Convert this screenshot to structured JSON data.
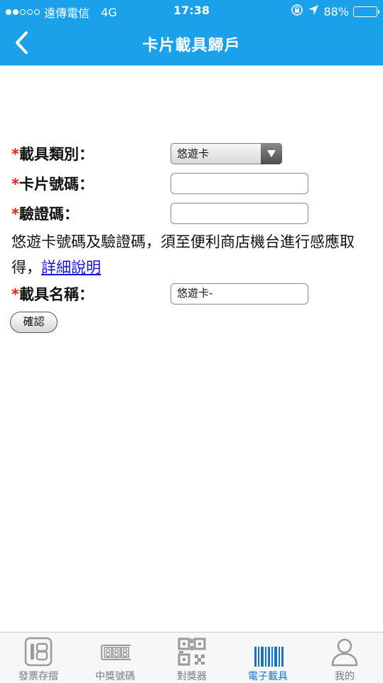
{
  "status_bar": {
    "carrier": "遠傳電信",
    "network": "4G",
    "time": "17:38",
    "battery": "88%"
  },
  "nav": {
    "back_icon": "chevron-left-icon",
    "title": "卡片載具歸戶"
  },
  "form": {
    "required_mark": "*",
    "carrier_type": {
      "label": "載具類別：",
      "value": "悠遊卡"
    },
    "card_number": {
      "label": "卡片號碼：",
      "value": ""
    },
    "verification_code": {
      "label": "驗證碼：",
      "value": ""
    },
    "note_text": "悠遊卡號碼及驗證碼，須至便利商店機台進行感應取得，",
    "note_link": "詳細說明",
    "carrier_name": {
      "label": "載具名稱：",
      "value": "悠遊卡-"
    },
    "confirm_label": "確認"
  },
  "tabs": [
    {
      "label": "發票存摺",
      "icon": "invoice-book-icon",
      "active": false
    },
    {
      "label": "中獎號碼",
      "icon": "winning-numbers-icon",
      "active": false
    },
    {
      "label": "對獎器",
      "icon": "qr-code-icon",
      "active": false
    },
    {
      "label": "電子載具",
      "icon": "barcode-icon",
      "active": true
    },
    {
      "label": "我的",
      "icon": "user-icon",
      "active": false
    }
  ],
  "colors": {
    "header": "#1AA1E9",
    "required": "#e0241b",
    "link": "#1010d8",
    "tab_active": "#1a73c8",
    "tab_inactive": "#7a7a7a"
  }
}
